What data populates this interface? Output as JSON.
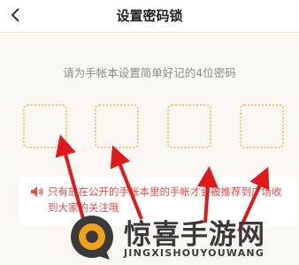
{
  "header": {
    "title": "设置密码锁",
    "back_icon": "chevron-left-icon"
  },
  "prompt": "请为手帐本设置简单好记的4位密码",
  "pin_slots": [
    "",
    "",
    "",
    ""
  ],
  "notice": {
    "icon": "speaker-icon",
    "text": "只有放在公开的手帐本里的手帐才会被推荐到广场收到大家的关注哦"
  },
  "watermark": {
    "cn": "惊喜手游网",
    "en": "JINGXISHOUYOUWANG"
  },
  "colors": {
    "accent_orange": "#f6c17a",
    "notice_red": "#ef4a49",
    "arrow_red": "#e0191b",
    "background": "#fbf8f3"
  }
}
